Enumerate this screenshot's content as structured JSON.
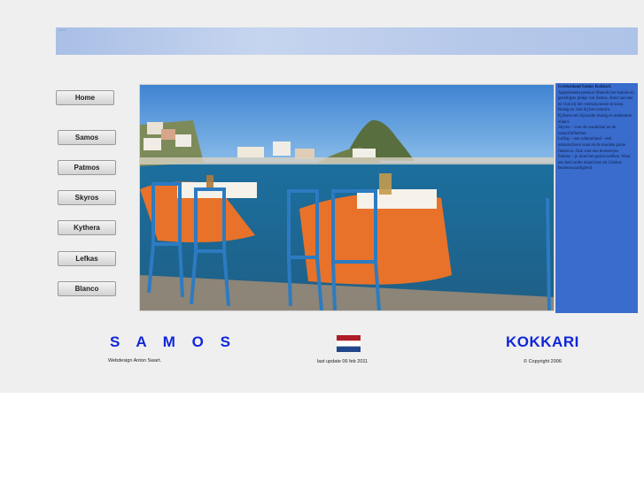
{
  "nav": {
    "home": "Home",
    "items": [
      "Samos",
      "Patmos",
      "Skyros",
      "Kythera",
      "Lefkas",
      "Blanco"
    ]
  },
  "info_panel": {
    "paragraphs": [
      "Griekenland Samos Kokkari.",
      "Appartement pension Manolis het leukste en gezelligste plekje van Samos, direct aan zee en vlak bij het centrum,mooie te koop. Rustig en vlak bij het centrum.",
      "Kythera een bijzonder mooig en authentiek eiland.",
      "Skyros – voor de wandelaar en de natuurliefhebber.",
      "Lefkas – een schiereiland –veel natuurschoon waar en de mooiste gooie fietsen is. Ook voor een bootreisjes.",
      "Patmos – je moet het gezien hebben. Waar een heel ander eiland met als Griekse bezienswaardigheid."
    ]
  },
  "footer": {
    "samos": "S A M O S",
    "kokkari": "KOKKARI",
    "webdesign": "Webdesign  Anton Swart.",
    "last_update": "last update 06 feb 2011",
    "copyright": "© Copyright 2006"
  },
  "colors": {
    "title_blue": "#1026d8",
    "panel_blue": "#3a6ccd",
    "flag": [
      "#ae1c28",
      "#ffffff",
      "#21468b"
    ]
  }
}
